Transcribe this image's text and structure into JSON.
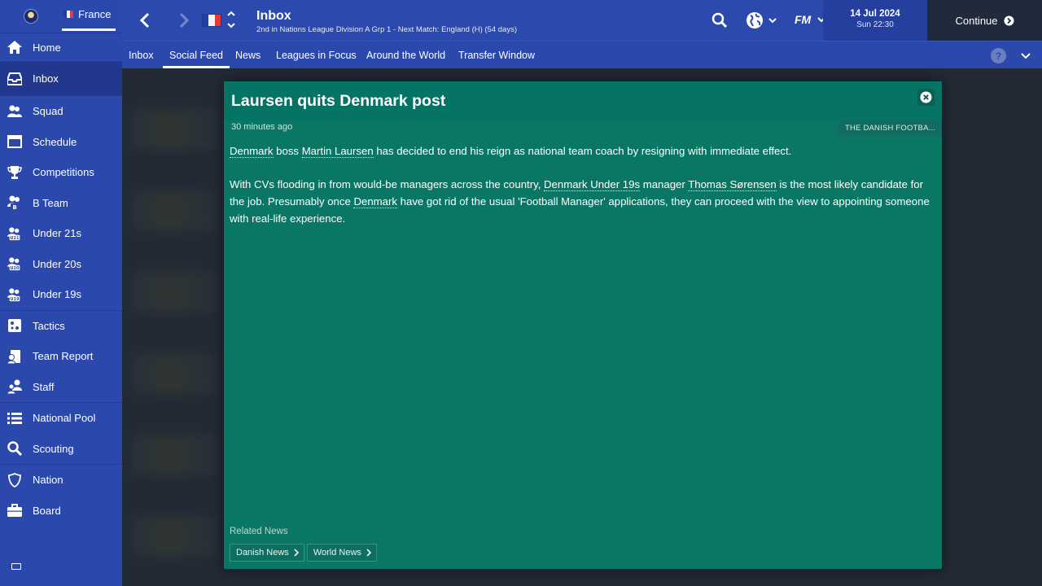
{
  "sidebar": {
    "country": "France",
    "items": [
      {
        "label": "Home",
        "icon": "home-icon"
      },
      {
        "label": "Inbox",
        "icon": "inbox-icon",
        "active": true
      },
      {
        "label": "Squad",
        "icon": "squad-icon"
      },
      {
        "label": "Schedule",
        "icon": "calendar-icon"
      },
      {
        "label": "Competitions",
        "icon": "trophy-icon"
      },
      {
        "label": "B Team",
        "icon": "b-team-icon"
      },
      {
        "label": "Under 21s",
        "icon": "u21-icon"
      },
      {
        "label": "Under 20s",
        "icon": "u20-icon"
      },
      {
        "label": "Under 19s",
        "icon": "u19-icon"
      },
      {
        "label": "Tactics",
        "icon": "tactics-icon"
      },
      {
        "label": "Team Report",
        "icon": "team-report-icon"
      },
      {
        "label": "Staff",
        "icon": "staff-icon"
      },
      {
        "label": "National Pool",
        "icon": "list-icon"
      },
      {
        "label": "Scouting",
        "icon": "search-icon"
      },
      {
        "label": "Nation",
        "icon": "shield-icon"
      },
      {
        "label": "Board",
        "icon": "briefcase-icon"
      }
    ]
  },
  "header": {
    "title": "Inbox",
    "subtitle": "2nd in Nations League Division A Grp 1 - Next Match: England (H) (54 days)",
    "date": "14 Jul 2024",
    "time": "Sun 22:30",
    "continue_label": "Continue",
    "fm_logo": "FM"
  },
  "tabs": [
    "Inbox",
    "Social Feed",
    "News",
    "Leagues in Focus",
    "Around the World",
    "Transfer Window"
  ],
  "active_tab": "Social Feed",
  "article": {
    "title": "Laursen quits Denmark post",
    "time_ago": "30 minutes ago",
    "source": "THE DANISH FOOTBA...",
    "p1": {
      "link1": "Denmark",
      "t1": " boss ",
      "link2": "Martin Laursen",
      "t2": " has decided to end his reign as national team coach by resigning with immediate effect."
    },
    "p2": {
      "t0": "With CVs flooding in from would-be managers across the country, ",
      "link1": "Denmark Under 19s",
      "t1": " manager ",
      "link2": "Thomas Sørensen",
      "t2": " is the most likely candidate for the job. Presumably once ",
      "link3": "Denmark",
      "t3": " have got rid of the usual 'Football Manager' applications, they can proceed with the view to appointing someone with real-life experience."
    },
    "related_label": "Related News",
    "related": [
      "Danish News",
      "World News"
    ]
  },
  "help_label": "?",
  "colors": {
    "sidebar": "#2b48ad",
    "modal": "#0a7765",
    "continue_bg": "#202a3a"
  }
}
